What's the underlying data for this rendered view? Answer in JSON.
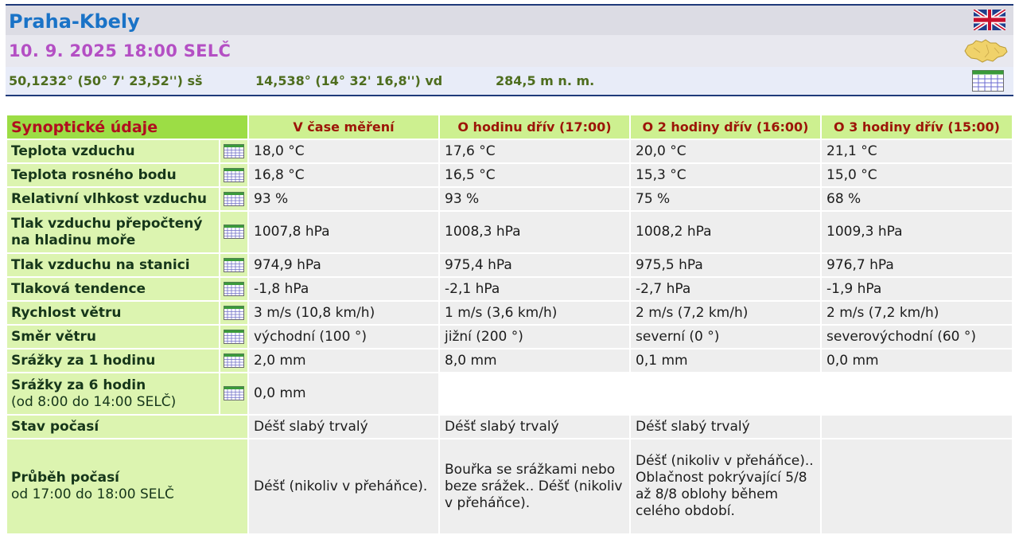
{
  "header": {
    "station": "Praha-Kbely",
    "datetime": "10. 9. 2025 18:00 SELČ",
    "latitude": "50,1232° (50° 7' 23,52'') sš",
    "longitude": "14,538° (14° 32' 16,8'') vd",
    "altitude": "284,5 m n. m."
  },
  "table": {
    "title": "Synoptické údaje",
    "columns": [
      "V čase měření",
      "O hodinu dřív (17:00)",
      "O 2 hodiny dřív (16:00)",
      "O 3 hodiny dřív (15:00)"
    ],
    "rows": [
      {
        "label": "Teplota vzduchu",
        "values": [
          "18,0 °C",
          "17,6 °C",
          "20,0 °C",
          "21,1 °C"
        ]
      },
      {
        "label": "Teplota rosného bodu",
        "values": [
          "16,8 °C",
          "16,5 °C",
          "15,3 °C",
          "15,0 °C"
        ]
      },
      {
        "label": "Relativní vlhkost vzduchu",
        "values": [
          "93 %",
          "93 %",
          "75 %",
          "68 %"
        ]
      },
      {
        "label1": "Tlak vzduchu přepočtený",
        "label2": "na hladinu moře",
        "values": [
          "1007,8 hPa",
          "1008,3 hPa",
          "1008,2 hPa",
          "1009,3 hPa"
        ]
      },
      {
        "label": "Tlak vzduchu na stanici",
        "values": [
          "974,9 hPa",
          "975,4 hPa",
          "975,5 hPa",
          "976,7 hPa"
        ]
      },
      {
        "label": "Tlaková tendence",
        "values": [
          "-1,8 hPa",
          "-2,1 hPa",
          "-2,7 hPa",
          "-1,9 hPa"
        ]
      },
      {
        "label": "Rychlost větru",
        "values": [
          "3 m/s (10,8 km/h)",
          "1 m/s (3,6 km/h)",
          "2 m/s (7,2 km/h)",
          "2 m/s (7,2 km/h)"
        ]
      },
      {
        "label": "Směr větru",
        "values": [
          "východní (100 °)",
          "jižní (200 °)",
          "severní (0 °)",
          "severovýchodní (60 °)"
        ]
      },
      {
        "label": "Srážky za 1 hodinu",
        "values": [
          "2,0 mm",
          "8,0 mm",
          "0,1 mm",
          "0,0 mm"
        ]
      },
      {
        "label": "Srážky za 6 hodin",
        "sub": "(od 8:00 do 14:00 SELČ)",
        "values": [
          "0,0 mm"
        ]
      },
      {
        "label": "Stav počasí",
        "values": [
          "Déšť slabý trvalý",
          "Déšť slabý trvalý",
          "Déšť slabý trvalý",
          ""
        ]
      },
      {
        "label": "Průběh počasí",
        "sub": "od 17:00 do 18:00 SELČ",
        "values": [
          "Déšť (nikoliv v přeháňce).",
          "Bouřka se srážkami nebo beze srážek.. Déšť (nikoliv v přeháňce).",
          "Déšť (nikoliv v přeháňce).. Oblačnost pokrývající 5/8 až 8/8 oblohy během celého období.",
          ""
        ]
      }
    ]
  },
  "icons": {
    "flag": "uk-flag-icon",
    "map": "czech-map-icon",
    "table": "table-icon"
  },
  "colors": {
    "station": "#1a73c7",
    "datetime": "#b44fc4",
    "coords": "#4e6d1e",
    "header_green": "#9cdd45",
    "label_green": "#dcf4b0",
    "title_red": "#b00e1f"
  }
}
